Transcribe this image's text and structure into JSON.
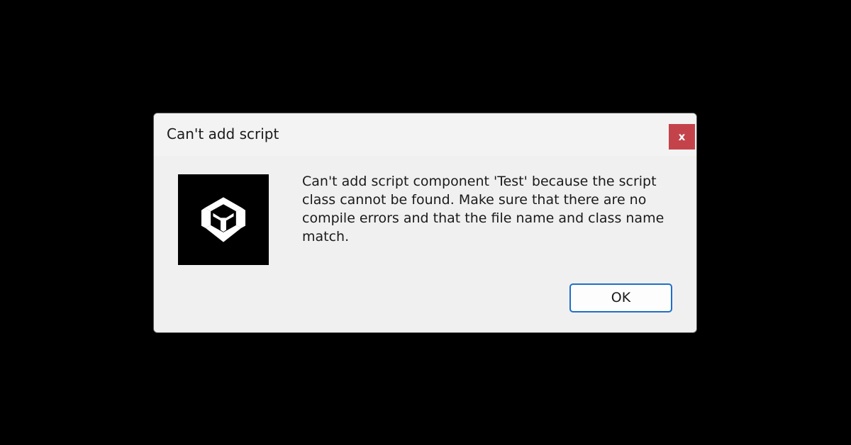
{
  "dialog": {
    "title": "Can't add script",
    "close_label": "x",
    "message": "Can't add script component 'Test' because the script class cannot be found. Make sure that there are no compile errors and that the file name and class name match.",
    "icon": "unity-logo-icon",
    "ok_label": "OK"
  },
  "colors": {
    "background": "#000000",
    "dialog_bg": "#f0f0f0",
    "close_button": "#c4434b",
    "ok_border": "#1f6fc8"
  }
}
